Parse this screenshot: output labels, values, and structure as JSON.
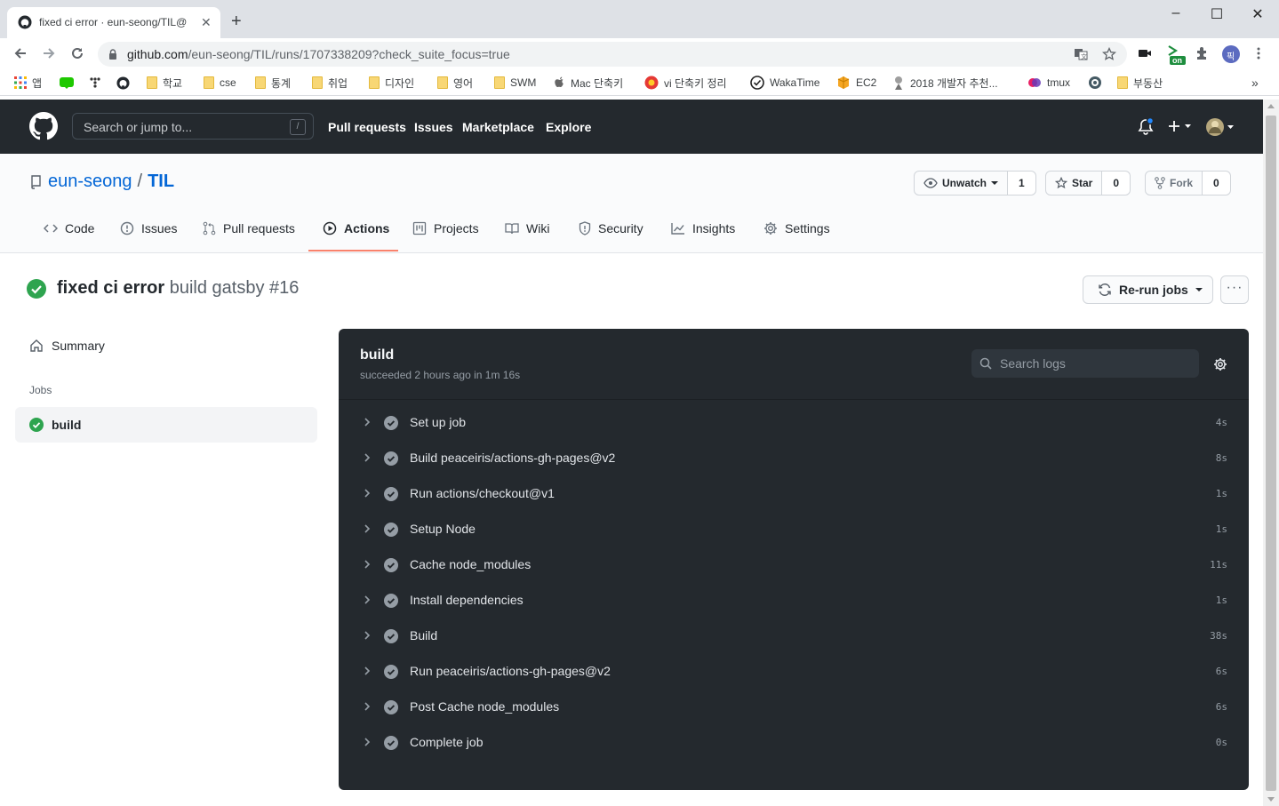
{
  "browser": {
    "tab_title": "fixed ci error · eun-seong/TIL@",
    "url_host": "github.com",
    "url_path": "/eun-seong/TIL/runs/1707338209?check_suite_focus=true",
    "bookmarks": [
      "앱",
      "학교",
      "cse",
      "통계",
      "취업",
      "디자인",
      "영어",
      "SWM",
      "Mac 단축키",
      "vi 단축키 정리",
      "WakaTime",
      "EC2",
      "2018 개발자 추천...",
      "tmux",
      "부동산"
    ],
    "extension_badge": "on",
    "profile_initial": "픽"
  },
  "github": {
    "search_placeholder": "Search or jump to...",
    "search_shortcut": "/",
    "nav": [
      "Pull requests",
      "Issues",
      "Marketplace",
      "Explore"
    ]
  },
  "repo": {
    "owner": "eun-seong",
    "separator": "/",
    "name": "TIL",
    "watch_label": "Unwatch",
    "watch_count": "1",
    "star_label": "Star",
    "star_count": "0",
    "fork_label": "Fork",
    "fork_count": "0",
    "tabs": [
      "Code",
      "Issues",
      "Pull requests",
      "Actions",
      "Projects",
      "Wiki",
      "Security",
      "Insights",
      "Settings"
    ],
    "active_tab": "Actions"
  },
  "run": {
    "commit_message": "fixed ci error",
    "workflow": "build gatsby #16",
    "rerun_label": "Re-run jobs",
    "more_label": "···"
  },
  "sidebar": {
    "summary_label": "Summary",
    "jobs_heading": "Jobs",
    "job_name": "build"
  },
  "job": {
    "title": "build",
    "status": "succeeded 2 hours ago in 1m 16s",
    "search_placeholder": "Search logs",
    "steps": [
      {
        "name": "Set up job",
        "duration": "4s"
      },
      {
        "name": "Build peaceiris/actions-gh-pages@v2",
        "duration": "8s"
      },
      {
        "name": "Run actions/checkout@v1",
        "duration": "1s"
      },
      {
        "name": "Setup Node",
        "duration": "1s"
      },
      {
        "name": "Cache node_modules",
        "duration": "11s"
      },
      {
        "name": "Install dependencies",
        "duration": "1s"
      },
      {
        "name": "Build",
        "duration": "38s"
      },
      {
        "name": "Run peaceiris/actions-gh-pages@v2",
        "duration": "6s"
      },
      {
        "name": "Post Cache node_modules",
        "duration": "6s"
      },
      {
        "name": "Complete job",
        "duration": "0s"
      }
    ]
  },
  "colors": {
    "success": "#2ea44f",
    "header_bg": "#24292e",
    "link": "#0366d6",
    "tab_underline": "#f9826c"
  }
}
